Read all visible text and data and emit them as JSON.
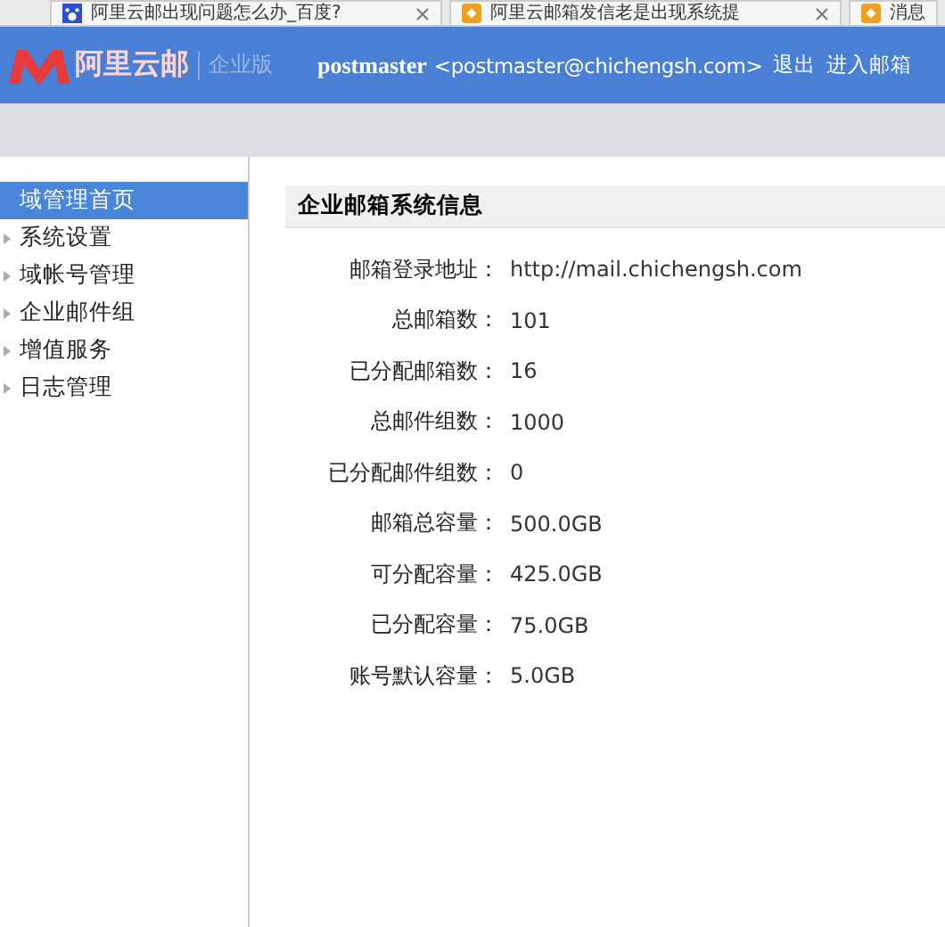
{
  "browser_tabs": [
    {
      "title": "阿里云邮出现问题怎么办_百度?",
      "closable": true
    },
    {
      "title": "阿里云邮箱发信老是出现系统提",
      "closable": true
    },
    {
      "title": "消息",
      "closable": false
    }
  ],
  "header": {
    "logo": "阿里云邮",
    "edition": "企业版",
    "user": "postmaster",
    "email": "<postmaster@chichengsh.com>",
    "links": [
      "退出",
      "进入邮箱"
    ]
  },
  "sidebar": {
    "items": [
      {
        "label": "域管理首页",
        "selected": true
      },
      {
        "label": "系统设置",
        "selected": false
      },
      {
        "label": "域帐号管理",
        "selected": false
      },
      {
        "label": "企业邮件组",
        "selected": false
      },
      {
        "label": "增值服务",
        "selected": false
      },
      {
        "label": "日志管理",
        "selected": false
      }
    ]
  },
  "panel": {
    "title": "企业邮箱系统信息",
    "rows": [
      {
        "label": "邮箱登录地址：",
        "value": "http://mail.chichengsh.com"
      },
      {
        "label": "总邮箱数：",
        "value": "101"
      },
      {
        "label": "已分配邮箱数：",
        "value": "16"
      },
      {
        "label": "总邮件组数：",
        "value": "1000"
      },
      {
        "label": "已分配邮件组数：",
        "value": "0"
      },
      {
        "label": "邮箱总容量：",
        "value": "500.0GB"
      },
      {
        "label": "可分配容量：",
        "value": "425.0GB"
      },
      {
        "label": "已分配容量：",
        "value": "75.0GB"
      },
      {
        "label": "账号默认容量：",
        "value": "5.0GB"
      }
    ]
  }
}
